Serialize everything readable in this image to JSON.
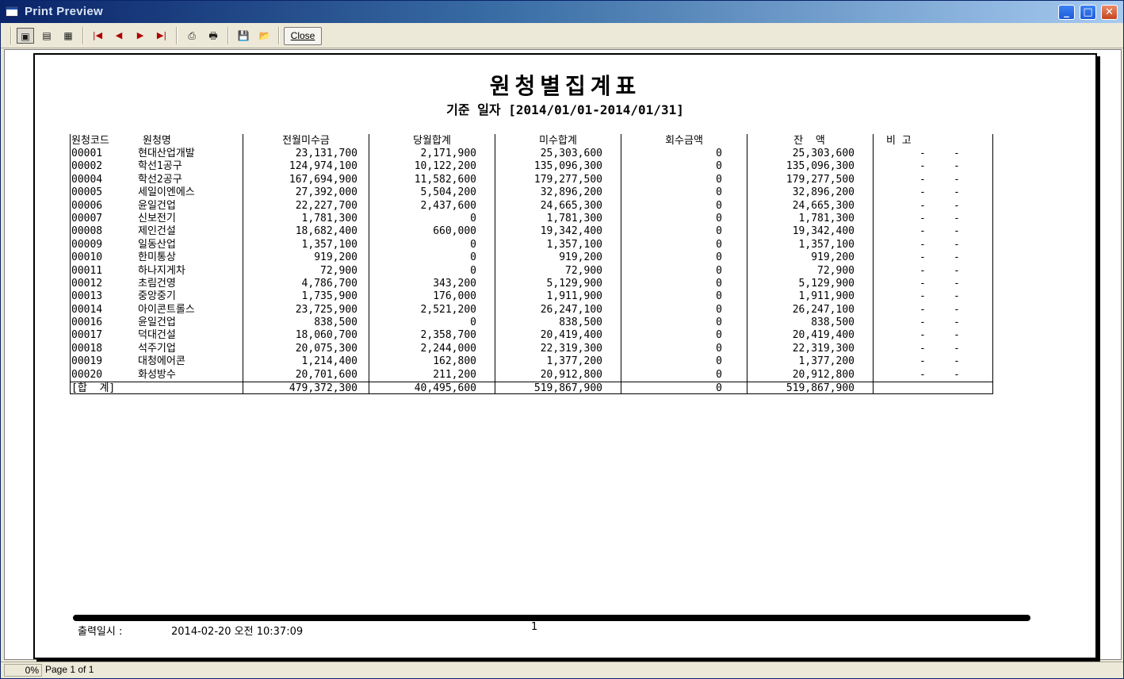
{
  "window": {
    "title": "Print Preview"
  },
  "toolbar": {
    "close_label": "Close"
  },
  "report": {
    "title": "원청별집계표",
    "subtitle": "기준 일자 [2014/01/01-2014/01/31]",
    "headers": {
      "code": "원청코드",
      "name": "원청명",
      "prev_unpaid": "전월미수금",
      "curr_total": "당월합계",
      "unpaid_total": "미수합계",
      "collected": "회수금액",
      "balance": "잔  액",
      "note": "비 고"
    },
    "rows": [
      {
        "code": "00001",
        "name": "현대산업개발",
        "prev": "23,131,700",
        "curr": "2,171,900",
        "unpaid": "25,303,600",
        "coll": "0",
        "bal": "25,303,600",
        "n1": "-",
        "n2": "-"
      },
      {
        "code": "00002",
        "name": "학선1공구",
        "prev": "124,974,100",
        "curr": "10,122,200",
        "unpaid": "135,096,300",
        "coll": "0",
        "bal": "135,096,300",
        "n1": "-",
        "n2": "-"
      },
      {
        "code": "00004",
        "name": "학선2공구",
        "prev": "167,694,900",
        "curr": "11,582,600",
        "unpaid": "179,277,500",
        "coll": "0",
        "bal": "179,277,500",
        "n1": "-",
        "n2": "-"
      },
      {
        "code": "00005",
        "name": "세일이엔에스",
        "prev": "27,392,000",
        "curr": "5,504,200",
        "unpaid": "32,896,200",
        "coll": "0",
        "bal": "32,896,200",
        "n1": "-",
        "n2": "-"
      },
      {
        "code": "00006",
        "name": "윤일건업",
        "prev": "22,227,700",
        "curr": "2,437,600",
        "unpaid": "24,665,300",
        "coll": "0",
        "bal": "24,665,300",
        "n1": "-",
        "n2": "-"
      },
      {
        "code": "00007",
        "name": "신보전기",
        "prev": "1,781,300",
        "curr": "0",
        "unpaid": "1,781,300",
        "coll": "0",
        "bal": "1,781,300",
        "n1": "-",
        "n2": "-"
      },
      {
        "code": "00008",
        "name": "제인건설",
        "prev": "18,682,400",
        "curr": "660,000",
        "unpaid": "19,342,400",
        "coll": "0",
        "bal": "19,342,400",
        "n1": "-",
        "n2": "-"
      },
      {
        "code": "00009",
        "name": "일동산업",
        "prev": "1,357,100",
        "curr": "0",
        "unpaid": "1,357,100",
        "coll": "0",
        "bal": "1,357,100",
        "n1": "-",
        "n2": "-"
      },
      {
        "code": "00010",
        "name": "한미통상",
        "prev": "919,200",
        "curr": "0",
        "unpaid": "919,200",
        "coll": "0",
        "bal": "919,200",
        "n1": "-",
        "n2": "-"
      },
      {
        "code": "00011",
        "name": "하나지게차",
        "prev": "72,900",
        "curr": "0",
        "unpaid": "72,900",
        "coll": "0",
        "bal": "72,900",
        "n1": "-",
        "n2": "-"
      },
      {
        "code": "00012",
        "name": "초림건영",
        "prev": "4,786,700",
        "curr": "343,200",
        "unpaid": "5,129,900",
        "coll": "0",
        "bal": "5,129,900",
        "n1": "-",
        "n2": "-"
      },
      {
        "code": "00013",
        "name": "중앙중기",
        "prev": "1,735,900",
        "curr": "176,000",
        "unpaid": "1,911,900",
        "coll": "0",
        "bal": "1,911,900",
        "n1": "-",
        "n2": "-"
      },
      {
        "code": "00014",
        "name": "아이콘트롤스",
        "prev": "23,725,900",
        "curr": "2,521,200",
        "unpaid": "26,247,100",
        "coll": "0",
        "bal": "26,247,100",
        "n1": "-",
        "n2": "-"
      },
      {
        "code": "00016",
        "name": "윤일건업",
        "prev": "838,500",
        "curr": "0",
        "unpaid": "838,500",
        "coll": "0",
        "bal": "838,500",
        "n1": "-",
        "n2": "-"
      },
      {
        "code": "00017",
        "name": "덕대건설",
        "prev": "18,060,700",
        "curr": "2,358,700",
        "unpaid": "20,419,400",
        "coll": "0",
        "bal": "20,419,400",
        "n1": "-",
        "n2": "-"
      },
      {
        "code": "00018",
        "name": "석주기업",
        "prev": "20,075,300",
        "curr": "2,244,000",
        "unpaid": "22,319,300",
        "coll": "0",
        "bal": "22,319,300",
        "n1": "-",
        "n2": "-"
      },
      {
        "code": "00019",
        "name": "대청에어콘",
        "prev": "1,214,400",
        "curr": "162,800",
        "unpaid": "1,377,200",
        "coll": "0",
        "bal": "1,377,200",
        "n1": "-",
        "n2": "-"
      },
      {
        "code": "00020",
        "name": "화성방수",
        "prev": "20,701,600",
        "curr": "211,200",
        "unpaid": "20,912,800",
        "coll": "0",
        "bal": "20,912,800",
        "n1": "-",
        "n2": "-"
      }
    ],
    "totals": {
      "label": "[합  계]",
      "prev": "479,372,300",
      "curr": "40,495,600",
      "unpaid": "519,867,900",
      "coll": "0",
      "bal": "519,867,900"
    },
    "footer": {
      "printed_label": "출력일시 :",
      "printed_at": "2014-02-20 오전 10:37:09",
      "page_number": "1"
    }
  },
  "status": {
    "zoom": "0%",
    "page": "Page 1 of 1"
  }
}
